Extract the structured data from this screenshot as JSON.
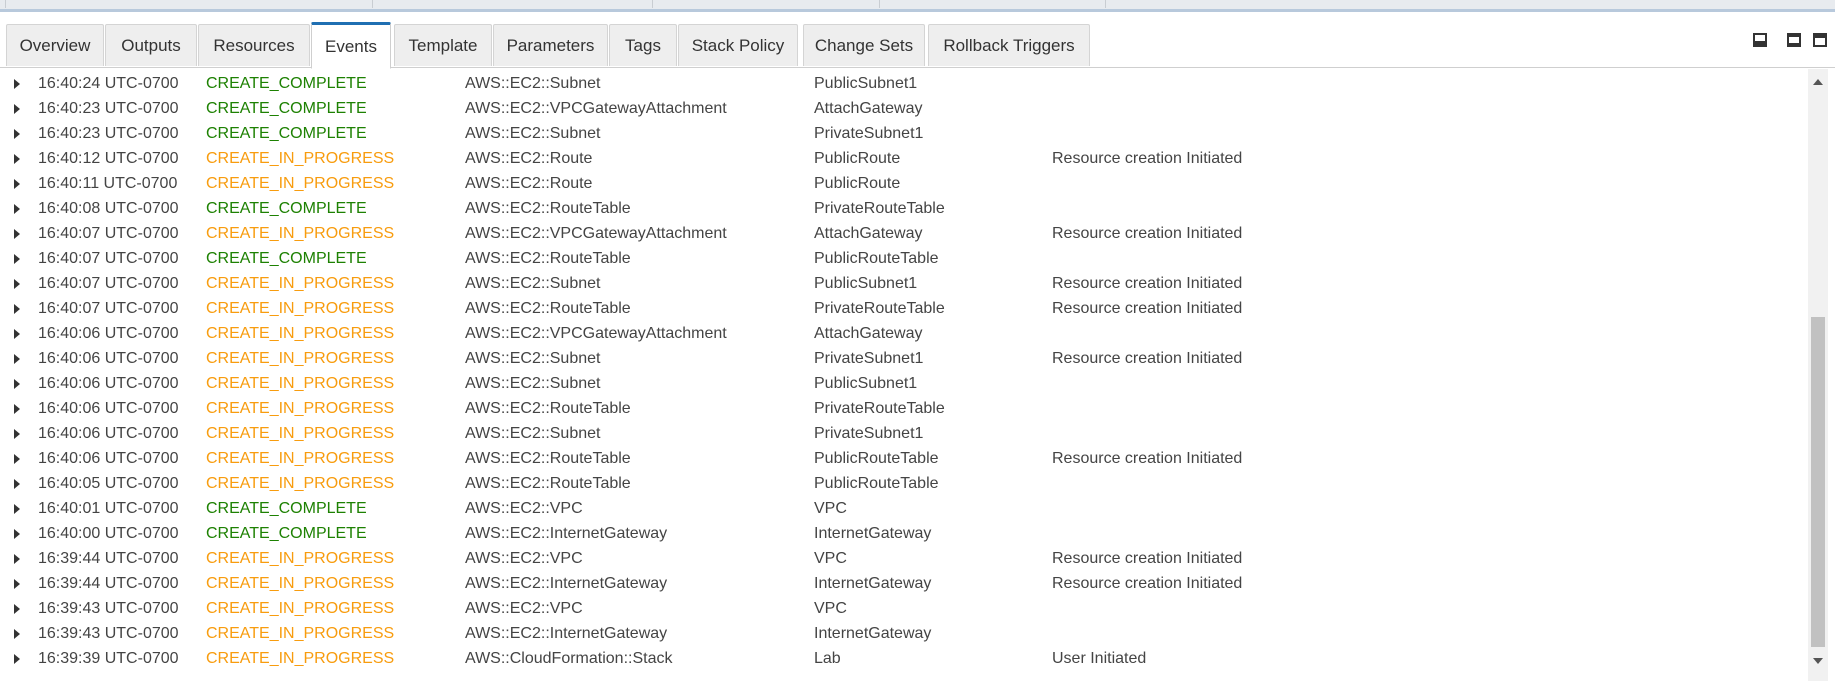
{
  "tabs": [
    {
      "label": "Overview"
    },
    {
      "label": "Outputs"
    },
    {
      "label": "Resources"
    },
    {
      "label": "Events"
    },
    {
      "label": "Template"
    },
    {
      "label": "Parameters"
    },
    {
      "label": "Tags"
    },
    {
      "label": "Stack Policy"
    },
    {
      "label": "Change Sets"
    },
    {
      "label": "Rollback Triggers"
    }
  ],
  "active_tab": "Events",
  "colors": {
    "complete": "#1d8102",
    "in_progress": "#f89c0e",
    "tab_accent": "#1f6fb2"
  },
  "icons": {
    "expand": "caret-right-icon",
    "layout": [
      "panel-minimize-icon",
      "panel-split-icon",
      "panel-maximize-icon"
    ]
  },
  "events": [
    {
      "time": "16:40:24 UTC-0700",
      "status": "CREATE_COMPLETE",
      "type": "AWS::EC2::Subnet",
      "logical_id": "PublicSubnet1",
      "reason": ""
    },
    {
      "time": "16:40:23 UTC-0700",
      "status": "CREATE_COMPLETE",
      "type": "AWS::EC2::VPCGatewayAttachment",
      "logical_id": "AttachGateway",
      "reason": ""
    },
    {
      "time": "16:40:23 UTC-0700",
      "status": "CREATE_COMPLETE",
      "type": "AWS::EC2::Subnet",
      "logical_id": "PrivateSubnet1",
      "reason": ""
    },
    {
      "time": "16:40:12 UTC-0700",
      "status": "CREATE_IN_PROGRESS",
      "type": "AWS::EC2::Route",
      "logical_id": "PublicRoute",
      "reason": "Resource creation Initiated"
    },
    {
      "time": "16:40:11 UTC-0700",
      "status": "CREATE_IN_PROGRESS",
      "type": "AWS::EC2::Route",
      "logical_id": "PublicRoute",
      "reason": ""
    },
    {
      "time": "16:40:08 UTC-0700",
      "status": "CREATE_COMPLETE",
      "type": "AWS::EC2::RouteTable",
      "logical_id": "PrivateRouteTable",
      "reason": ""
    },
    {
      "time": "16:40:07 UTC-0700",
      "status": "CREATE_IN_PROGRESS",
      "type": "AWS::EC2::VPCGatewayAttachment",
      "logical_id": "AttachGateway",
      "reason": "Resource creation Initiated"
    },
    {
      "time": "16:40:07 UTC-0700",
      "status": "CREATE_COMPLETE",
      "type": "AWS::EC2::RouteTable",
      "logical_id": "PublicRouteTable",
      "reason": ""
    },
    {
      "time": "16:40:07 UTC-0700",
      "status": "CREATE_IN_PROGRESS",
      "type": "AWS::EC2::Subnet",
      "logical_id": "PublicSubnet1",
      "reason": "Resource creation Initiated"
    },
    {
      "time": "16:40:07 UTC-0700",
      "status": "CREATE_IN_PROGRESS",
      "type": "AWS::EC2::RouteTable",
      "logical_id": "PrivateRouteTable",
      "reason": "Resource creation Initiated"
    },
    {
      "time": "16:40:06 UTC-0700",
      "status": "CREATE_IN_PROGRESS",
      "type": "AWS::EC2::VPCGatewayAttachment",
      "logical_id": "AttachGateway",
      "reason": ""
    },
    {
      "time": "16:40:06 UTC-0700",
      "status": "CREATE_IN_PROGRESS",
      "type": "AWS::EC2::Subnet",
      "logical_id": "PrivateSubnet1",
      "reason": "Resource creation Initiated"
    },
    {
      "time": "16:40:06 UTC-0700",
      "status": "CREATE_IN_PROGRESS",
      "type": "AWS::EC2::Subnet",
      "logical_id": "PublicSubnet1",
      "reason": ""
    },
    {
      "time": "16:40:06 UTC-0700",
      "status": "CREATE_IN_PROGRESS",
      "type": "AWS::EC2::RouteTable",
      "logical_id": "PrivateRouteTable",
      "reason": ""
    },
    {
      "time": "16:40:06 UTC-0700",
      "status": "CREATE_IN_PROGRESS",
      "type": "AWS::EC2::Subnet",
      "logical_id": "PrivateSubnet1",
      "reason": ""
    },
    {
      "time": "16:40:06 UTC-0700",
      "status": "CREATE_IN_PROGRESS",
      "type": "AWS::EC2::RouteTable",
      "logical_id": "PublicRouteTable",
      "reason": "Resource creation Initiated"
    },
    {
      "time": "16:40:05 UTC-0700",
      "status": "CREATE_IN_PROGRESS",
      "type": "AWS::EC2::RouteTable",
      "logical_id": "PublicRouteTable",
      "reason": ""
    },
    {
      "time": "16:40:01 UTC-0700",
      "status": "CREATE_COMPLETE",
      "type": "AWS::EC2::VPC",
      "logical_id": "VPC",
      "reason": ""
    },
    {
      "time": "16:40:00 UTC-0700",
      "status": "CREATE_COMPLETE",
      "type": "AWS::EC2::InternetGateway",
      "logical_id": "InternetGateway",
      "reason": ""
    },
    {
      "time": "16:39:44 UTC-0700",
      "status": "CREATE_IN_PROGRESS",
      "type": "AWS::EC2::VPC",
      "logical_id": "VPC",
      "reason": "Resource creation Initiated"
    },
    {
      "time": "16:39:44 UTC-0700",
      "status": "CREATE_IN_PROGRESS",
      "type": "AWS::EC2::InternetGateway",
      "logical_id": "InternetGateway",
      "reason": "Resource creation Initiated"
    },
    {
      "time": "16:39:43 UTC-0700",
      "status": "CREATE_IN_PROGRESS",
      "type": "AWS::EC2::VPC",
      "logical_id": "VPC",
      "reason": ""
    },
    {
      "time": "16:39:43 UTC-0700",
      "status": "CREATE_IN_PROGRESS",
      "type": "AWS::EC2::InternetGateway",
      "logical_id": "InternetGateway",
      "reason": ""
    },
    {
      "time": "16:39:39 UTC-0700",
      "status": "CREATE_IN_PROGRESS",
      "type": "AWS::CloudFormation::Stack",
      "logical_id": "Lab",
      "reason": "User Initiated"
    }
  ]
}
